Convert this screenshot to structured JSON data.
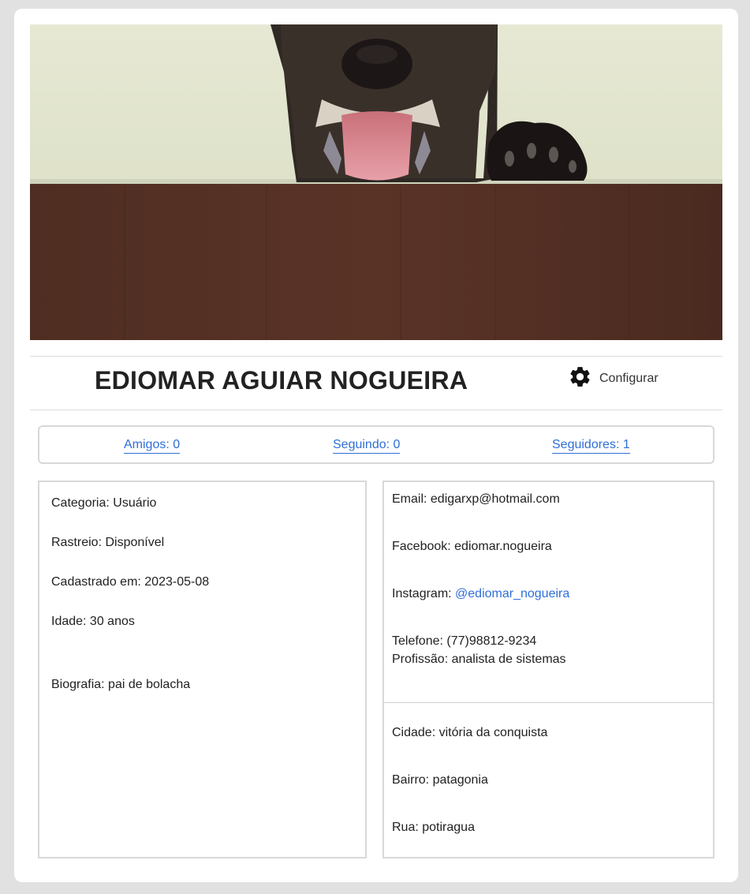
{
  "profile": {
    "name": "EDIOMAR AGUIAR NOGUEIRA",
    "config_label": "Configurar"
  },
  "stats": {
    "friends": "Amigos: 0",
    "following": "Seguindo: 0",
    "followers": "Seguidores: 1"
  },
  "info": {
    "category": "Categoria: Usuário",
    "tracking": "Rastreio: Disponível",
    "registered": "Cadastrado em: 2023-05-08",
    "age": "Idade: 30 anos",
    "bio": "Biografia: pai de bolacha"
  },
  "contact": {
    "email": "Email: edigarxp@hotmail.com",
    "facebook": "Facebook: ediomar.nogueira",
    "instagram_label": "Instagram: ",
    "instagram_handle": "@ediomar_nogueira",
    "phone": "Telefone: (77)98812-9234",
    "profession": "Profissão: analista de sistemas"
  },
  "address": {
    "city": "Cidade: vitória da conquista",
    "district": "Bairro: patagonia",
    "street": "Rua: potiragua"
  },
  "icons": {
    "config": "gear-icon"
  },
  "colors": {
    "link": "#2f6fd6",
    "background": "#e0e1e0"
  }
}
